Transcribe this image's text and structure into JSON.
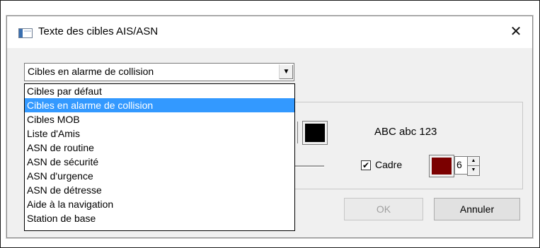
{
  "window": {
    "title": "Texte des cibles AIS/ASN",
    "close_glyph": "✕"
  },
  "combo": {
    "value": "Cibles en alarme de collision",
    "arrow_glyph": "▼"
  },
  "dropdown": {
    "items": [
      {
        "label": "Cibles par défaut",
        "selected": false
      },
      {
        "label": "Cibles en alarme de collision",
        "selected": true
      },
      {
        "label": "Cibles MOB",
        "selected": false
      },
      {
        "label": "Liste d'Amis",
        "selected": false
      },
      {
        "label": "ASN de routine",
        "selected": false
      },
      {
        "label": "ASN de sécurité",
        "selected": false
      },
      {
        "label": "ASN d'urgence",
        "selected": false
      },
      {
        "label": "ASN de détresse",
        "selected": false
      },
      {
        "label": "Aide à la navigation",
        "selected": false
      },
      {
        "label": "Station de base",
        "selected": false
      }
    ]
  },
  "preview": {
    "text": "ABC abc 123",
    "text_color": "#000000"
  },
  "frame": {
    "checkbox_checked": true,
    "check_glyph": "✔",
    "label": "Cadre",
    "color": "#7b0000",
    "width_value": "6",
    "spin_up_glyph": "▲",
    "spin_down_glyph": "▼"
  },
  "buttons": {
    "ok_label": "OK",
    "cancel_label": "Annuler"
  },
  "colors": {
    "selection": "#3399ff",
    "dialog_bg": "#f0f0f0"
  }
}
